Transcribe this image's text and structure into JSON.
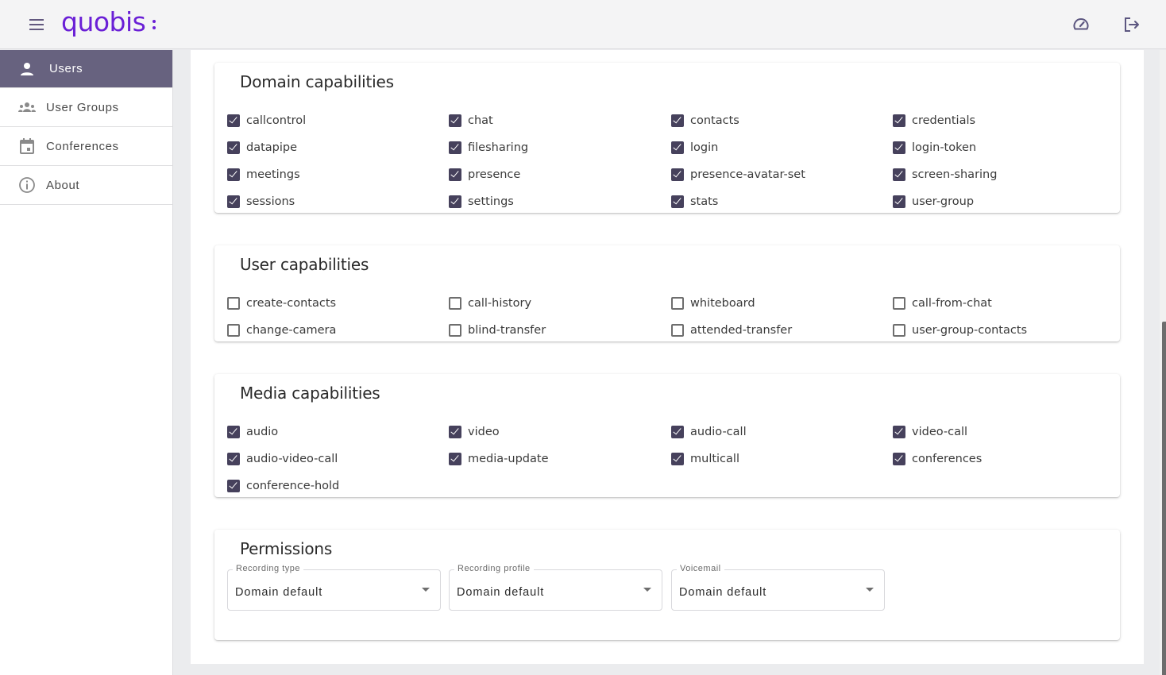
{
  "header": {
    "logo_text": "quobis",
    "icons": {
      "menu": "hamburger-menu-icon",
      "dashboard": "speedometer-icon",
      "logout": "logout-icon"
    }
  },
  "sidebar": {
    "items": [
      {
        "label": "Users",
        "icon": "person-icon",
        "active": true
      },
      {
        "label": "User Groups",
        "icon": "groups-icon",
        "active": false
      },
      {
        "label": "Conferences",
        "icon": "calendar-icon",
        "active": false
      },
      {
        "label": "About",
        "icon": "info-icon",
        "active": false
      }
    ]
  },
  "colors": {
    "accent": "#67627f",
    "brand": "#6a1fd6",
    "checkbox_checked": "#46415c"
  },
  "sections": {
    "domain": {
      "title": "Domain capabilities",
      "items": [
        {
          "label": "callcontrol",
          "checked": true
        },
        {
          "label": "chat",
          "checked": true
        },
        {
          "label": "contacts",
          "checked": true
        },
        {
          "label": "credentials",
          "checked": true
        },
        {
          "label": "datapipe",
          "checked": true
        },
        {
          "label": "filesharing",
          "checked": true
        },
        {
          "label": "login",
          "checked": true
        },
        {
          "label": "login-token",
          "checked": true
        },
        {
          "label": "meetings",
          "checked": true
        },
        {
          "label": "presence",
          "checked": true
        },
        {
          "label": "presence-avatar-set",
          "checked": true
        },
        {
          "label": "screen-sharing",
          "checked": true
        },
        {
          "label": "sessions",
          "checked": true
        },
        {
          "label": "settings",
          "checked": true
        },
        {
          "label": "stats",
          "checked": true
        },
        {
          "label": "user-group",
          "checked": true
        }
      ]
    },
    "user": {
      "title": "User capabilities",
      "items": [
        {
          "label": "create-contacts",
          "checked": false
        },
        {
          "label": "call-history",
          "checked": false
        },
        {
          "label": "whiteboard",
          "checked": false
        },
        {
          "label": "call-from-chat",
          "checked": false
        },
        {
          "label": "change-camera",
          "checked": false
        },
        {
          "label": "blind-transfer",
          "checked": false
        },
        {
          "label": "attended-transfer",
          "checked": false
        },
        {
          "label": "user-group-contacts",
          "checked": false
        }
      ]
    },
    "media": {
      "title": "Media capabilities",
      "items": [
        {
          "label": "audio",
          "checked": true
        },
        {
          "label": "video",
          "checked": true
        },
        {
          "label": "audio-call",
          "checked": true
        },
        {
          "label": "video-call",
          "checked": true
        },
        {
          "label": "audio-video-call",
          "checked": true
        },
        {
          "label": "media-update",
          "checked": true
        },
        {
          "label": "multicall",
          "checked": true
        },
        {
          "label": "conferences",
          "checked": true
        },
        {
          "label": "conference-hold",
          "checked": true
        }
      ]
    },
    "permissions": {
      "title": "Permissions",
      "selects": [
        {
          "label": "Recording type",
          "value": "Domain default"
        },
        {
          "label": "Recording profile",
          "value": "Domain default"
        },
        {
          "label": "Voicemail",
          "value": "Domain default"
        }
      ]
    }
  }
}
